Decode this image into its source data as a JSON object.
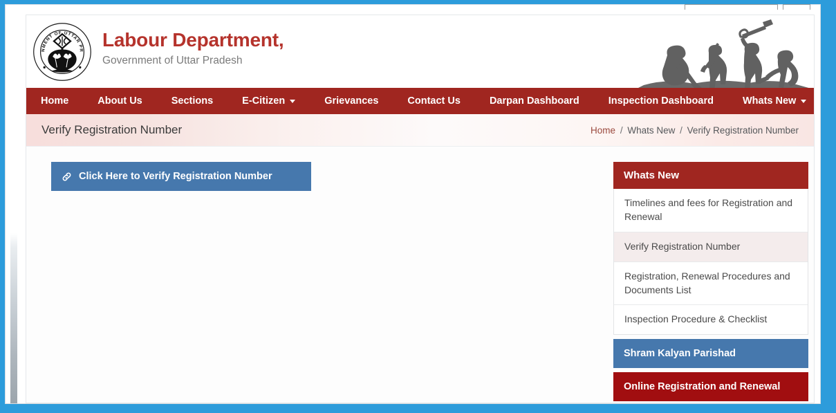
{
  "window": {
    "frame_color": "#2d9cdb"
  },
  "header": {
    "emblem_text": "GOVERNMENT OF UTTAR PRADESH",
    "emblem_name": "uttar-pradesh-state-emblem",
    "title": "Labour Department,",
    "subtitle": "Government of Uttar Pradesh",
    "title_color": "#b5332c",
    "banner_name": "labourers-silhouette-banner"
  },
  "nav": {
    "background": "#a02620",
    "items": [
      {
        "label": "Home",
        "has_caret": false
      },
      {
        "label": "About Us",
        "has_caret": false
      },
      {
        "label": "Sections",
        "has_caret": false
      },
      {
        "label": "E-Citizen",
        "has_caret": true
      },
      {
        "label": "Grievances",
        "has_caret": false
      },
      {
        "label": "Contact Us",
        "has_caret": false
      },
      {
        "label": "Darpan Dashboard",
        "has_caret": false
      },
      {
        "label": "Inspection Dashboard",
        "has_caret": false
      },
      {
        "label": "Whats New",
        "has_caret": true
      }
    ]
  },
  "title_bar": {
    "page_title": "Verify Registration Number",
    "breadcrumb": {
      "home": "Home",
      "sep1": "/",
      "section": "Whats New",
      "sep2": "/",
      "current": "Verify Registration Number"
    }
  },
  "main": {
    "verify_button": {
      "label": "Click Here to Verify Registration Number",
      "icon": "link-chain-icon",
      "background": "#4678ad"
    }
  },
  "sidebar": {
    "panel_title": "Whats New",
    "panel_title_background": "#a02620",
    "items": [
      {
        "label": "Timelines and fees for Registration and Renewal",
        "active": false
      },
      {
        "label": "Verify Registration Number",
        "active": true
      },
      {
        "label": "Registration, Renewal Procedures and Documents List",
        "active": false
      },
      {
        "label": "Inspection Procedure & Checklist",
        "active": false
      }
    ],
    "bars": [
      {
        "label": "Shram Kalyan Parishad",
        "color": "#4678ad"
      },
      {
        "label": "Online Registration and Renewal",
        "color": "#a10e10"
      }
    ]
  }
}
